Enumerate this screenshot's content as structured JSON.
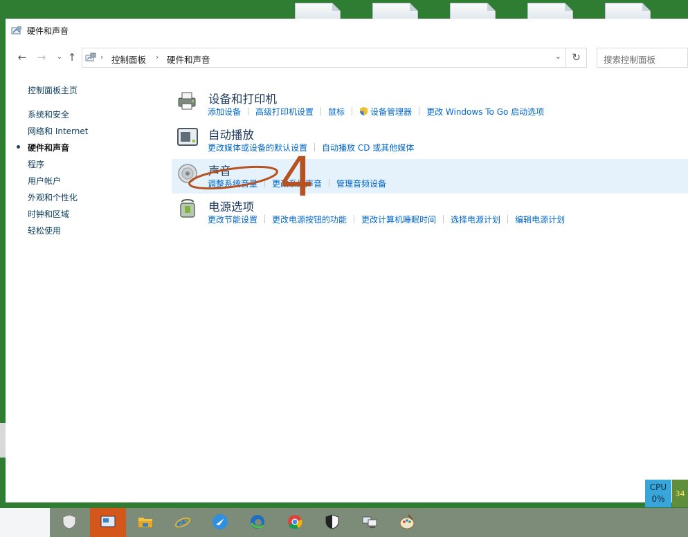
{
  "window": {
    "title": "硬件和声音"
  },
  "address_bar": {
    "crumbs": [
      "控制面板",
      "硬件和声音"
    ],
    "search_placeholder": "搜索控制面板"
  },
  "sidebar": {
    "items": [
      {
        "label": "控制面板主页",
        "current": false
      },
      {
        "label": "系统和安全",
        "current": false
      },
      {
        "label": "网络和 Internet",
        "current": false
      },
      {
        "label": "硬件和声音",
        "current": true
      },
      {
        "label": "程序",
        "current": false
      },
      {
        "label": "用户帐户",
        "current": false
      },
      {
        "label": "外观和个性化",
        "current": false
      },
      {
        "label": "时钟和区域",
        "current": false
      },
      {
        "label": "轻松使用",
        "current": false
      }
    ]
  },
  "categories": [
    {
      "title": "设备和打印机",
      "icon": "printer-icon",
      "links": [
        "添加设备",
        "高级打印机设置",
        "鼠标",
        "设备管理器",
        "更改 Windows To Go 启动选项"
      ]
    },
    {
      "title": "自动播放",
      "icon": "autoplay-icon",
      "links": [
        "更改媒体或设备的默认设置",
        "自动播放 CD 或其他媒体"
      ]
    },
    {
      "title": "声音",
      "icon": "speaker-icon",
      "links": [
        "调整系统音量",
        "更改系统声音",
        "管理音频设备"
      ]
    },
    {
      "title": "电源选项",
      "icon": "power-options-icon",
      "links": [
        "更改节能设置",
        "更改电源按钮的功能",
        "更改计算机睡眠时间",
        "选择电源计划",
        "编辑电源计划"
      ]
    }
  ],
  "annotation": {
    "number": "4",
    "color": "#b5521f"
  },
  "cpu_widget": {
    "label": "CPU",
    "value": "0%",
    "side_value": "34"
  },
  "taskbar": {
    "items": [
      "shield-defender-icon",
      "control-panel-icon",
      "file-explorer-icon",
      "internet-explorer-icon",
      "feather-app-icon",
      "edge-icon",
      "chrome-icon",
      "security-shield-icon",
      "network-computers-icon",
      "paint-palette-icon"
    ],
    "active_index": 1
  },
  "colors": {
    "link": "#0066cc",
    "heading": "#1e395b",
    "highlight": "#e5f1fb",
    "desktop": "#2e7d32",
    "taskbar": "#7d8c78",
    "taskbar_active": "#d5561a"
  }
}
